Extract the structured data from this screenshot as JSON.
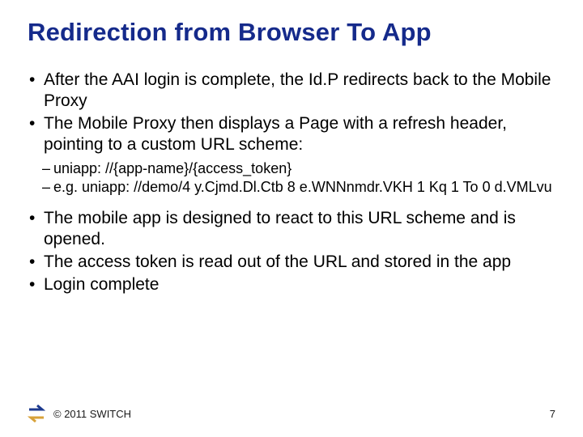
{
  "title": "Redirection from Browser To App",
  "bullets": {
    "b1": "After the AAI login is complete, the Id.P redirects back to the Mobile Proxy",
    "b2": "The Mobile Proxy then displays a Page with a refresh header, pointing to a custom URL scheme:",
    "s1": "uniapp: //{app-name}/{access_token}",
    "s2": "e.g. uniapp: //demo/4 y.Cjmd.Dl.Ctb 8 e.WNNnmdr.VKH 1 Kq 1 To 0 d.VMLvu",
    "b3": "The mobile app is designed to react to this URL scheme and is opened.",
    "b4": "The access token is read out of the URL and stored in the app",
    "b5": "Login complete"
  },
  "footer": {
    "copyright": "© 2011 SWITCH",
    "page": "7"
  },
  "colors": {
    "title": "#152a8b",
    "logo_blue": "#1d3a8f",
    "logo_orange": "#d8a23a"
  }
}
